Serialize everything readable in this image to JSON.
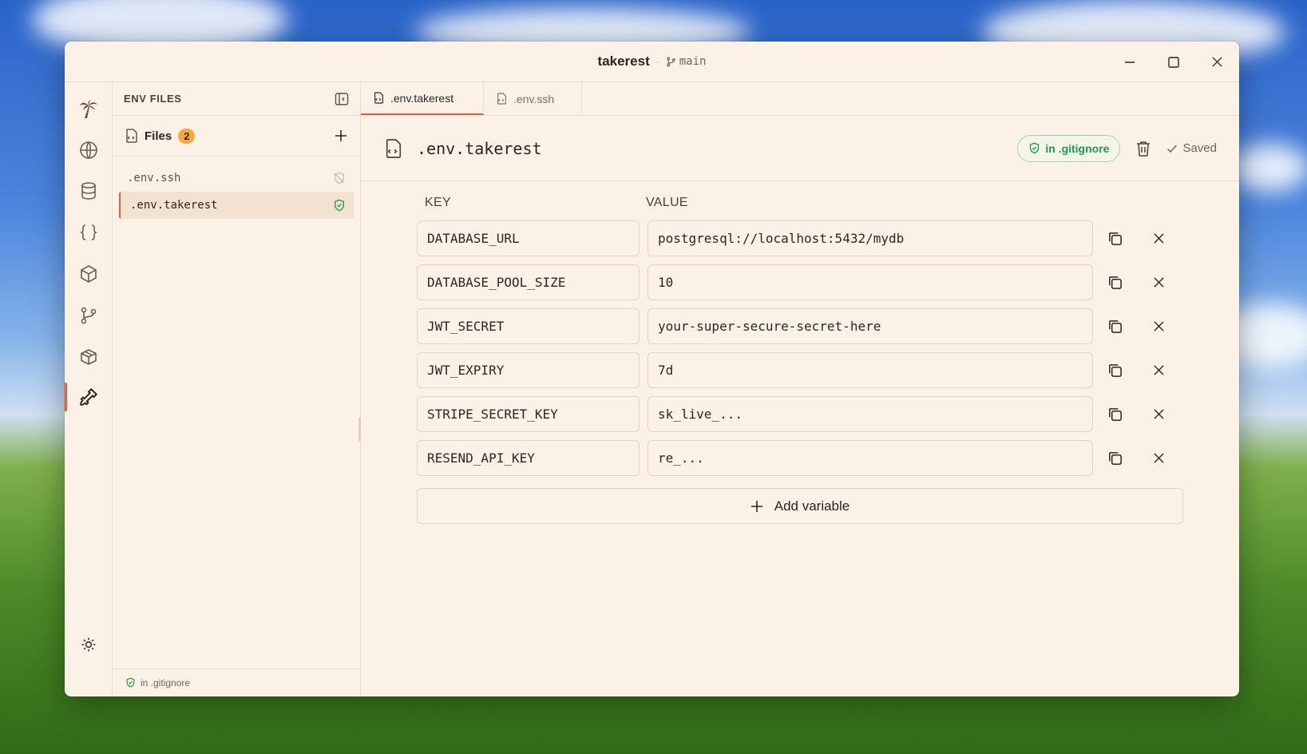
{
  "window": {
    "app_name": "takerest",
    "separator": "·",
    "branch": "main"
  },
  "rail": {
    "icons": [
      "palm-logo-icon",
      "globe-icon",
      "database-icon",
      "braces-icon",
      "box-icon",
      "git-branch-icon",
      "package-icon",
      "key-icon"
    ],
    "active": "key-icon"
  },
  "sidebar": {
    "title": "ENV FILES",
    "files_label": "Files",
    "files_count": "2",
    "files": [
      {
        "name": ".env.ssh",
        "status": "not-ignored"
      },
      {
        "name": ".env.takerest",
        "status": "ignored"
      }
    ],
    "footer": "in .gitignore"
  },
  "tabs": [
    {
      "label": ".env.takerest",
      "active": true
    },
    {
      "label": ".env.ssh",
      "active": false
    }
  ],
  "file": {
    "name": ".env.takerest",
    "gitignore_label": "in .gitignore",
    "saved_label": "Saved"
  },
  "table": {
    "key_header": "KEY",
    "value_header": "VALUE",
    "rows": [
      {
        "key": "DATABASE_URL",
        "value": "postgresql://localhost:5432/mydb"
      },
      {
        "key": "DATABASE_POOL_SIZE",
        "value": "10"
      },
      {
        "key": "JWT_SECRET",
        "value": "your-super-secure-secret-here"
      },
      {
        "key": "JWT_EXPIRY",
        "value": "7d"
      },
      {
        "key": "STRIPE_SECRET_KEY",
        "value": "sk_live_..."
      },
      {
        "key": "RESEND_API_KEY",
        "value": "re_..."
      }
    ],
    "add_label": "Add variable"
  },
  "colors": {
    "accent": "#e2603f",
    "badge": "#f4a93f",
    "success": "#1f9b45",
    "background": "#fbf1e6"
  }
}
